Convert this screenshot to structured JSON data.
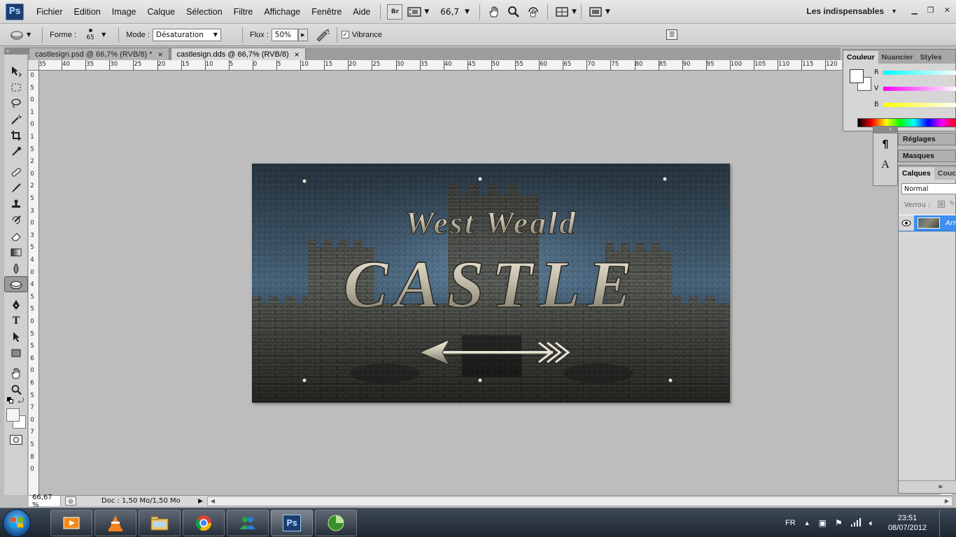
{
  "app": {
    "logo_text": "Ps",
    "menu": [
      "Fichier",
      "Edition",
      "Image",
      "Calque",
      "Sélection",
      "Filtre",
      "Affichage",
      "Fenêtre",
      "Aide"
    ],
    "bridge_label": "Br",
    "zoom": "66,7",
    "workspace": "Les indispensables"
  },
  "options": {
    "forme_label": "Forme :",
    "brush_size": "65",
    "mode_label": "Mode :",
    "mode_value": "Désaturation",
    "flux_label": "Flux :",
    "flux_value": "50%",
    "vibrance_label": "Vibrance",
    "vibrance_check": "✓"
  },
  "tabs": [
    {
      "label": "castlesign.psd @ 66,7% (RVB/8) *",
      "close": "×",
      "active": false
    },
    {
      "label": "castlesign.dds @ 66,7% (RVB/8)",
      "close": "×",
      "active": true
    }
  ],
  "ruler": {
    "h_labels": [
      "35",
      "40",
      "35",
      "30",
      "25",
      "20",
      "15",
      "10",
      "5",
      "0",
      "5",
      "10",
      "15",
      "20",
      "25",
      "30",
      "35",
      "40",
      "45",
      "50",
      "55",
      "60",
      "65",
      "70",
      "75",
      "80",
      "85",
      "90",
      "95",
      "100",
      "105",
      "110",
      "115",
      "120"
    ],
    "v_labels": [
      "0",
      "5",
      "0",
      "1",
      "0",
      "1",
      "5",
      "2",
      "0",
      "2",
      "5",
      "3",
      "0",
      "3",
      "5",
      "4",
      "0",
      "4",
      "5",
      "5",
      "0",
      "5",
      "5",
      "6",
      "0",
      "6",
      "5",
      "7",
      "0",
      "7",
      "5",
      "8",
      "0"
    ]
  },
  "artwork": {
    "line1": "West Weald",
    "line2": "CASTLE"
  },
  "status": {
    "zoom": "66,67 %",
    "doc": "Doc : 1,50 Mo/1,50 Mo"
  },
  "color_panel": {
    "tabs": [
      "Couleur",
      "Nuancier",
      "Styles"
    ],
    "r_label": "R",
    "v_label": "V",
    "b_label": "B"
  },
  "side_panels": {
    "reglages": "Réglages",
    "masques": "Masques",
    "paragraph_glyph": "¶",
    "char_glyph": "A"
  },
  "layers": {
    "tabs": [
      "Calques",
      "Couch"
    ],
    "blend_mode": "Normal",
    "lock_label": "Verrou :",
    "layer_name": "Arr"
  },
  "taskbar": {
    "lang": "FR",
    "time": "23:51",
    "date": "08/07/2012"
  },
  "colors": {
    "accent_blue": "#3d8ef0",
    "ps_blue": "#1c3d6e"
  }
}
